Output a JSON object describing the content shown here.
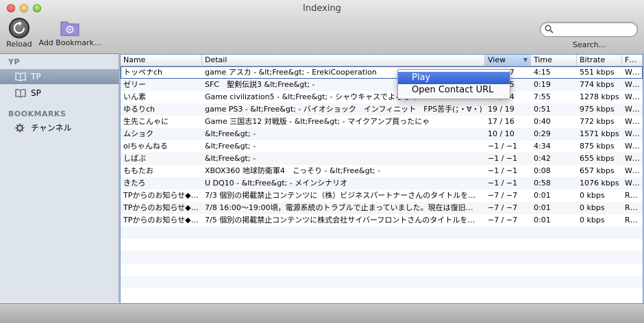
{
  "window": {
    "title": "Indexing"
  },
  "toolbar": {
    "reload_label": "Reload",
    "add_bookmark_label": "Add Bookmark...",
    "search_label": "Search...",
    "search_value": "",
    "search_placeholder": ""
  },
  "sidebar": {
    "sections": [
      {
        "heading": "YP",
        "items": [
          "TP",
          "SP"
        ]
      },
      {
        "heading": "BOOKMARKS",
        "items": [
          "チャンネル"
        ]
      }
    ]
  },
  "table": {
    "columns": [
      "Name",
      "Detail",
      "View",
      "Time",
      "Bitrate",
      "F…"
    ],
    "sorted_column": "View",
    "rows": [
      [
        "トッペナch",
        "game アスカ - &lt;Free&gt; - ErekiCooperation",
        "17 / 17",
        "4:15",
        "551 kbps",
        "W…"
      ],
      [
        "ゼリー",
        "SFC　聖剣伝説3 &lt;Free&gt; -",
        "15 / 15",
        "0:19",
        "774 kbps",
        "W…"
      ],
      [
        "いん素",
        "Game civilization5 - &lt;Free&gt; - シャウキャスでよろしく",
        "14 / 14",
        "7:55",
        "1278 kbps",
        "W…"
      ],
      [
        "ゆるりch",
        "game PS3 - &lt;Free&gt; - バイオショック　インフィニット　FPS苦手(；・∀・)",
        "19 / 19",
        "0:51",
        "975 kbps",
        "W…"
      ],
      [
        "生先こんゃに",
        "Game 三国志12 対戦版 - &lt;Free&gt; - マイクアンプ買ったにゃ",
        "17 / 16",
        "0:40",
        "772 kbps",
        "W…"
      ],
      [
        "ムショク",
        " &lt;Free&gt; -",
        "10 / 10",
        "0:29",
        "1571 kbps",
        "W…"
      ],
      [
        "oiちゃんねる",
        " &lt;Free&gt; -",
        "−1 / −1",
        "4:34",
        "875 kbps",
        "W…"
      ],
      [
        "しばぶ",
        " &lt;Free&gt; -",
        "−1 / −1",
        "0:42",
        "655 kbps",
        "W…"
      ],
      [
        "ももたお",
        "XBOX360 地球防衛軍4　こっそり - &lt;Free&gt; -",
        "−1 / −1",
        "0:08",
        "657 kbps",
        "W…"
      ],
      [
        "きたろ",
        "U DQ10 - &lt;Free&gt; - メインシナリオ",
        "−1 / −1",
        "0:58",
        "1076 kbps",
        "W…"
      ],
      [
        "TPからのお知らせ◆…",
        "7/3 個別の掲載禁止コンテンツに（株）ビジネスパートナーさんのタイトルを…",
        "−7 / −7",
        "0:01",
        "0 kbps",
        "R…"
      ],
      [
        "TPからのお知らせ◆…",
        "7/8 16:00～19:00頃，電源系統のトラブルで止まっていました。現在は復旧…",
        "−7 / −7",
        "0:01",
        "0 kbps",
        "R…"
      ],
      [
        "TPからのお知らせ◆…",
        "7/5 個別の掲載禁止コンテンツに株式会社サイバーフロントさんのタイトルを…",
        "−7 / −7",
        "0:01",
        "0 kbps",
        "R…"
      ]
    ]
  },
  "context_menu": {
    "items": [
      "Play",
      "Open Contact URL"
    ],
    "highlighted": "Play"
  },
  "colors": {
    "selection": "#3b62a6",
    "menu_highlight": "#2c5ed4",
    "sidebar_bg": "#dde4ec"
  },
  "icons": {
    "reload": "reload-icon",
    "bookmark": "gear-folder-icon",
    "source": "book-icon",
    "bookmark_item": "gear-icon",
    "search": "magnifier-icon"
  }
}
